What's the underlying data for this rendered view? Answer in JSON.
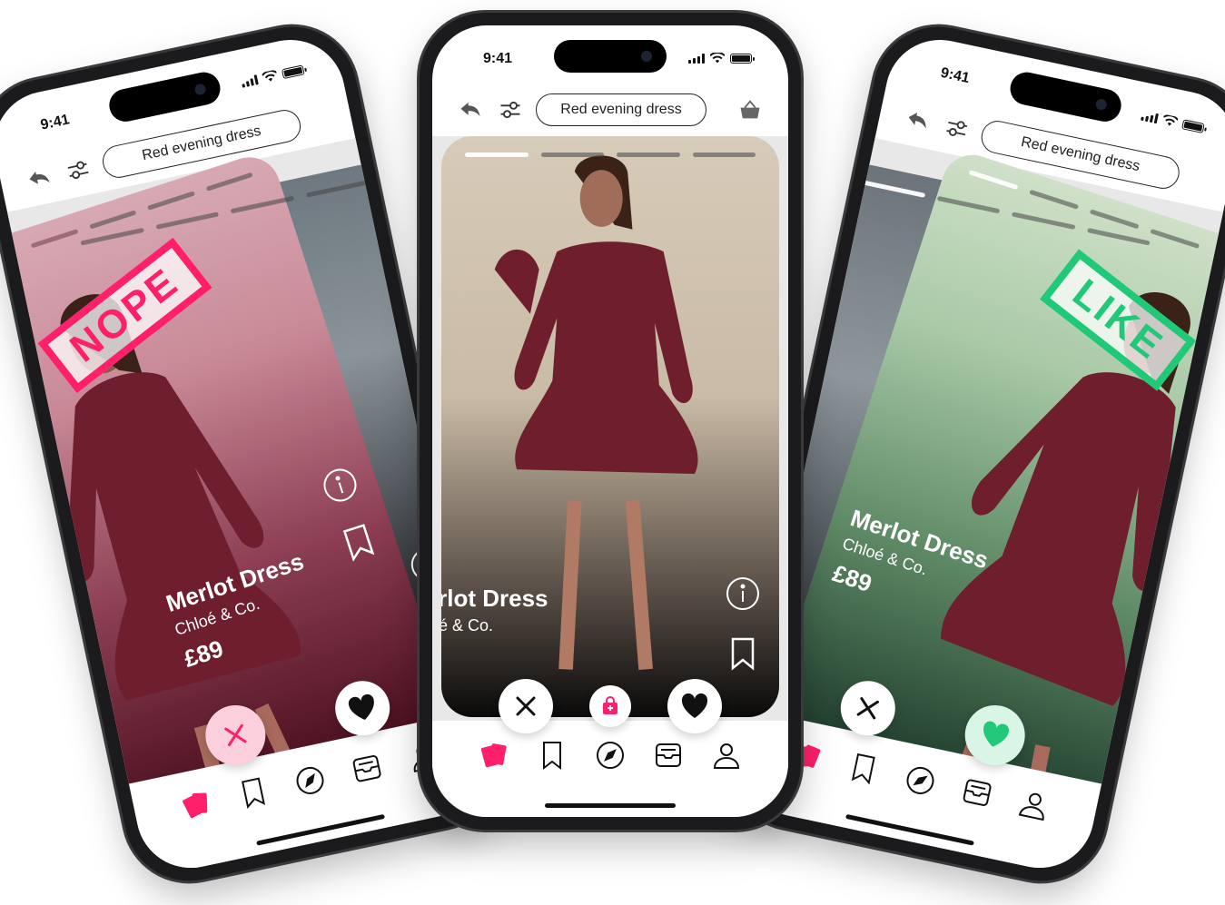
{
  "status": {
    "time": "9:41"
  },
  "search": {
    "query": "Red evening dress"
  },
  "product": {
    "name": "Merlot Dress",
    "brand": "Chloé & Co.",
    "price": "£89"
  },
  "stamps": {
    "nope": "NOPE",
    "like": "LIKE"
  },
  "colors": {
    "accent": "#ff1f6b",
    "like": "#20c977",
    "dress": "#6e1e2c",
    "nope_tint": "#c98a98",
    "like_tint": "#a8c9a6"
  },
  "icons": {
    "back": "undo-arrow-icon",
    "filter": "sliders-icon",
    "basket": "basket-icon",
    "info": "info-icon",
    "save": "bookmark-icon",
    "dislike": "close-icon",
    "shop": "shopping-bag-icon",
    "like": "heart-icon",
    "tabs": [
      "cards-icon",
      "bookmark-icon",
      "compass-icon",
      "inbox-icon",
      "profile-icon"
    ]
  },
  "progress": {
    "segments": 4,
    "active_index": 0
  }
}
